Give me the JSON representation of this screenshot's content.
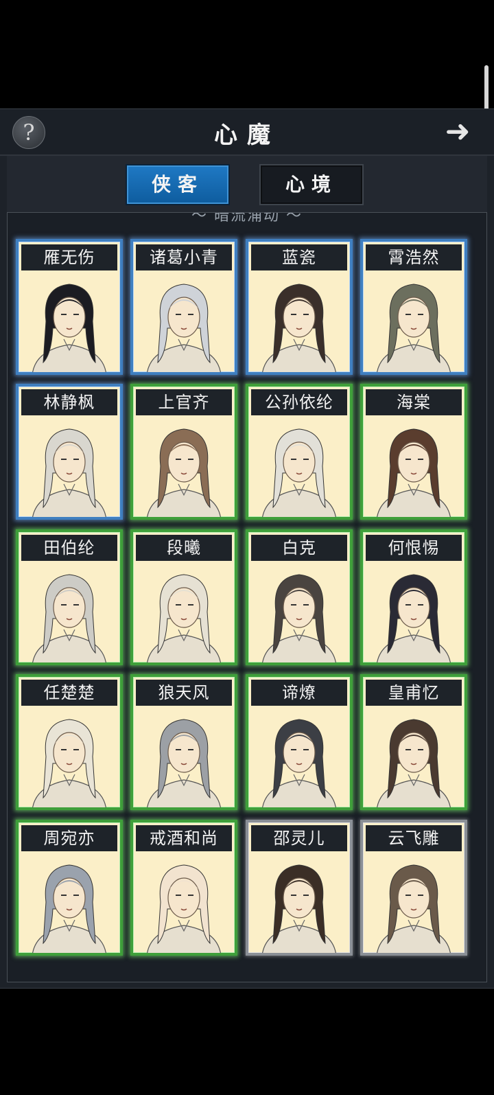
{
  "header": {
    "title": "心魔",
    "help_label": "?",
    "next_label": "➜"
  },
  "tabs": [
    {
      "label": "侠客",
      "active": true
    },
    {
      "label": "心境",
      "active": false
    }
  ],
  "section": {
    "label": "～ 暗流涌动 ～"
  },
  "cards": [
    {
      "name": "雁无伤",
      "frame": "blue"
    },
    {
      "name": "诸葛小青",
      "frame": "blue"
    },
    {
      "name": "蓝瓷",
      "frame": "blue"
    },
    {
      "name": "霄浩然",
      "frame": "blue"
    },
    {
      "name": "林静枫",
      "frame": "blue"
    },
    {
      "name": "上官齐",
      "frame": "green"
    },
    {
      "name": "公孙依纶",
      "frame": "green"
    },
    {
      "name": "海棠",
      "frame": "green"
    },
    {
      "name": "田伯纶",
      "frame": "green"
    },
    {
      "name": "段曦",
      "frame": "green"
    },
    {
      "name": "白克",
      "frame": "green"
    },
    {
      "name": "何恨惕",
      "frame": "green"
    },
    {
      "name": "任楚楚",
      "frame": "green"
    },
    {
      "name": "狼天风",
      "frame": "green"
    },
    {
      "name": "谛燎",
      "frame": "green"
    },
    {
      "name": "皇甫忆",
      "frame": "green"
    },
    {
      "name": "周宛亦",
      "frame": "green"
    },
    {
      "name": "戒酒和尚",
      "frame": "green"
    },
    {
      "name": "邵灵儿",
      "frame": "white"
    },
    {
      "name": "云飞雕",
      "frame": "white"
    }
  ],
  "colors": {
    "blue_frame": "#3f7fc0",
    "green_frame": "#3f9f3a",
    "card_bg": "#fbefc8",
    "active_tab": "#1f79c4"
  }
}
